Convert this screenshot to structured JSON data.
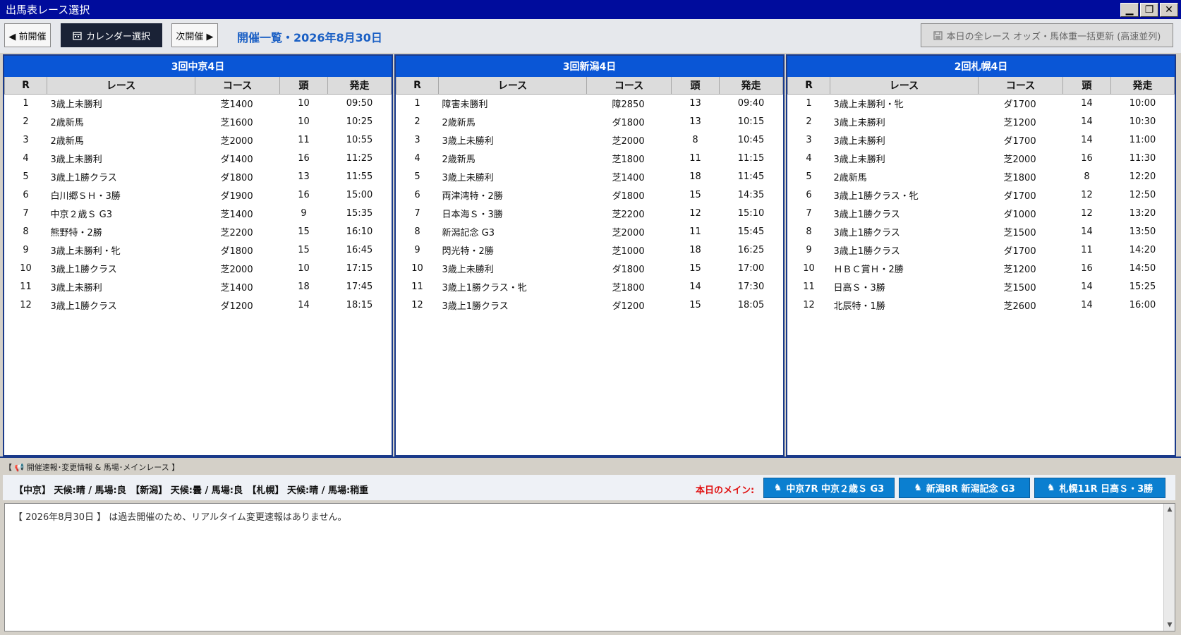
{
  "window": {
    "title": "出馬表レース選択",
    "min": "▁",
    "max": "❐",
    "close": "✕"
  },
  "toolbar": {
    "prev_label": "◀ 前開催",
    "calendar_label": "カレンダー選択",
    "next_label": "次開催 ▶",
    "page_title": "開催一覧・2026年8月30日",
    "bulk_update_label": "本日の全レース オッズ・馬体重一括更新 (高速並列)"
  },
  "columns": {
    "r": "R",
    "race": "レース",
    "course": "コース",
    "heads": "頭",
    "start": "発走"
  },
  "venues": [
    {
      "name": "3回中京4日",
      "races": [
        {
          "r": "1",
          "race": "3歳上未勝利",
          "course": "芝1400",
          "heads": "10",
          "start": "09:50"
        },
        {
          "r": "2",
          "race": "2歳新馬",
          "course": "芝1600",
          "heads": "10",
          "start": "10:25"
        },
        {
          "r": "3",
          "race": "2歳新馬",
          "course": "芝2000",
          "heads": "11",
          "start": "10:55"
        },
        {
          "r": "4",
          "race": "3歳上未勝利",
          "course": "ダ1400",
          "heads": "16",
          "start": "11:25"
        },
        {
          "r": "5",
          "race": "3歳上1勝クラス",
          "course": "ダ1800",
          "heads": "13",
          "start": "11:55"
        },
        {
          "r": "6",
          "race": "白川郷ＳＨ・3勝",
          "course": "ダ1900",
          "heads": "16",
          "start": "15:00"
        },
        {
          "r": "7",
          "race": "中京２歳Ｓ G3",
          "course": "芝1400",
          "heads": "9",
          "start": "15:35"
        },
        {
          "r": "8",
          "race": "熊野特・2勝",
          "course": "芝2200",
          "heads": "15",
          "start": "16:10"
        },
        {
          "r": "9",
          "race": "3歳上未勝利・牝",
          "course": "ダ1800",
          "heads": "15",
          "start": "16:45"
        },
        {
          "r": "10",
          "race": "3歳上1勝クラス",
          "course": "芝2000",
          "heads": "10",
          "start": "17:15"
        },
        {
          "r": "11",
          "race": "3歳上未勝利",
          "course": "芝1400",
          "heads": "18",
          "start": "17:45"
        },
        {
          "r": "12",
          "race": "3歳上1勝クラス",
          "course": "ダ1200",
          "heads": "14",
          "start": "18:15"
        }
      ]
    },
    {
      "name": "3回新潟4日",
      "races": [
        {
          "r": "1",
          "race": "障害未勝利",
          "course": "障2850",
          "heads": "13",
          "start": "09:40"
        },
        {
          "r": "2",
          "race": "2歳新馬",
          "course": "ダ1800",
          "heads": "13",
          "start": "10:15"
        },
        {
          "r": "3",
          "race": "3歳上未勝利",
          "course": "芝2000",
          "heads": "8",
          "start": "10:45"
        },
        {
          "r": "4",
          "race": "2歳新馬",
          "course": "芝1800",
          "heads": "11",
          "start": "11:15"
        },
        {
          "r": "5",
          "race": "3歳上未勝利",
          "course": "芝1400",
          "heads": "18",
          "start": "11:45"
        },
        {
          "r": "6",
          "race": "両津湾特・2勝",
          "course": "ダ1800",
          "heads": "15",
          "start": "14:35"
        },
        {
          "r": "7",
          "race": "日本海Ｓ・3勝",
          "course": "芝2200",
          "heads": "12",
          "start": "15:10"
        },
        {
          "r": "8",
          "race": "新潟記念 G3",
          "course": "芝2000",
          "heads": "11",
          "start": "15:45"
        },
        {
          "r": "9",
          "race": "閃光特・2勝",
          "course": "芝1000",
          "heads": "18",
          "start": "16:25"
        },
        {
          "r": "10",
          "race": "3歳上未勝利",
          "course": "ダ1800",
          "heads": "15",
          "start": "17:00"
        },
        {
          "r": "11",
          "race": "3歳上1勝クラス・牝",
          "course": "芝1800",
          "heads": "14",
          "start": "17:30"
        },
        {
          "r": "12",
          "race": "3歳上1勝クラス",
          "course": "ダ1200",
          "heads": "15",
          "start": "18:05"
        }
      ]
    },
    {
      "name": "2回札幌4日",
      "races": [
        {
          "r": "1",
          "race": "3歳上未勝利・牝",
          "course": "ダ1700",
          "heads": "14",
          "start": "10:00"
        },
        {
          "r": "2",
          "race": "3歳上未勝利",
          "course": "芝1200",
          "heads": "14",
          "start": "10:30"
        },
        {
          "r": "3",
          "race": "3歳上未勝利",
          "course": "ダ1700",
          "heads": "14",
          "start": "11:00"
        },
        {
          "r": "4",
          "race": "3歳上未勝利",
          "course": "芝2000",
          "heads": "16",
          "start": "11:30"
        },
        {
          "r": "5",
          "race": "2歳新馬",
          "course": "芝1800",
          "heads": "8",
          "start": "12:20"
        },
        {
          "r": "6",
          "race": "3歳上1勝クラス・牝",
          "course": "ダ1700",
          "heads": "12",
          "start": "12:50"
        },
        {
          "r": "7",
          "race": "3歳上1勝クラス",
          "course": "ダ1000",
          "heads": "12",
          "start": "13:20"
        },
        {
          "r": "8",
          "race": "3歳上1勝クラス",
          "course": "芝1500",
          "heads": "14",
          "start": "13:50"
        },
        {
          "r": "9",
          "race": "3歳上1勝クラス",
          "course": "ダ1700",
          "heads": "11",
          "start": "14:20"
        },
        {
          "r": "10",
          "race": "ＨＢＣ賞Ｈ・2勝",
          "course": "芝1200",
          "heads": "16",
          "start": "14:50"
        },
        {
          "r": "11",
          "race": "日高Ｓ・3勝",
          "course": "芝1500",
          "heads": "14",
          "start": "15:25"
        },
        {
          "r": "12",
          "race": "北辰特・1勝",
          "course": "芝2600",
          "heads": "14",
          "start": "16:00"
        }
      ]
    }
  ],
  "info": {
    "section_label": "【 📢 開催速報･変更情報 & 馬場･メインレース 】",
    "weather": "【中京】 天候:晴 / 馬場:良　【新潟】 天候:曇 / 馬場:良　【札幌】 天候:晴 / 馬場:稍重",
    "main_label": "本日のメイン:",
    "main_races": [
      "中京7R 中京２歳Ｓ G3",
      "新潟8R 新潟記念 G3",
      "札幌11R 日高Ｓ・3勝"
    ],
    "log_text": "【 2026年8月30日 】 は過去開催のため、リアルタイム変更速報はありません。"
  },
  "colors": {
    "title_bar": "#000c9c",
    "venue_header": "#0a56d6",
    "main_button": "#0b7fd0",
    "accent_red": "#e01010",
    "page_title": "#1a5fc4"
  }
}
